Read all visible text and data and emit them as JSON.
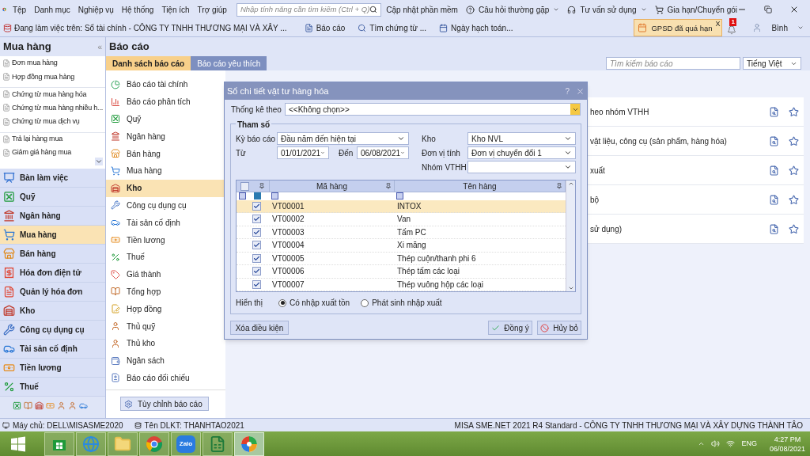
{
  "menu": {
    "items": [
      "Tệp",
      "Danh mục",
      "Nghiệp vụ",
      "Hệ thống",
      "Tiện ích",
      "Trợ giúp"
    ],
    "search_placeholder": "Nhập tính năng cần tìm kiếm (Ctrl + Q)",
    "links": [
      {
        "kind": "update",
        "label": "Cập nhật phần mềm"
      },
      {
        "kind": "help",
        "label": "Câu hỏi thường gặp"
      },
      {
        "kind": "support",
        "label": "Tư vấn sử dụng"
      },
      {
        "kind": "cart",
        "label": "Gia hạn/Chuyển gói"
      }
    ]
  },
  "toolbar": {
    "working_on": "Đang làm việc trên: Sổ tài chính - CÔNG TY TNHH THƯƠNG MẠI VÀ XÂY ...",
    "buttons": [
      {
        "kind": "report",
        "label": "Báo cáo"
      },
      {
        "kind": "search",
        "label": "Tìm chứng từ ..."
      },
      {
        "kind": "calendar",
        "label": "Ngày hạch toán..."
      }
    ],
    "alert": {
      "label": "GPSD đã quá hạn",
      "close": "X"
    },
    "notifications": "1",
    "user": "Bình"
  },
  "sidebar": {
    "title": "Mua hàng",
    "collapse": "«",
    "sub_items": [
      "Đơn mua hàng",
      "Hợp đồng mua hàng",
      "Chứng từ mua hàng hóa",
      "Chứng từ mua hàng nhiều h...",
      "Chứng từ mua dịch vụ",
      "Trả lại hàng mua",
      "Giảm giá hàng mua"
    ],
    "modules": [
      {
        "label": "Bàn làm việc",
        "kind": "desk",
        "selected": false
      },
      {
        "label": "Quỹ",
        "kind": "safe",
        "selected": false
      },
      {
        "label": "Ngân hàng",
        "kind": "bank",
        "selected": false
      },
      {
        "label": "Mua hàng",
        "kind": "cart",
        "selected": true
      },
      {
        "label": "Bán hàng",
        "kind": "store",
        "selected": false
      },
      {
        "label": "Hóa đơn điện tử",
        "kind": "einvoice",
        "selected": false
      },
      {
        "label": "Quản lý hóa đơn",
        "kind": "invoice",
        "selected": false
      },
      {
        "label": "Kho",
        "kind": "warehouse",
        "selected": false
      },
      {
        "label": "Công cụ dụng cụ",
        "kind": "tools",
        "selected": false
      },
      {
        "label": "Tài sản cố định",
        "kind": "car",
        "selected": false
      },
      {
        "label": "Tiền lương",
        "kind": "salary",
        "selected": false
      },
      {
        "label": "Thuế",
        "kind": "tax",
        "selected": false
      }
    ]
  },
  "reports": {
    "title": "Báo cáo",
    "tabs": [
      {
        "label": "Danh sách báo cáo",
        "selected": true
      },
      {
        "label": "Báo cáo yêu thích",
        "selected": false
      }
    ],
    "search_placeholder": "Tìm kiếm báo cáo",
    "language": "Tiếng Việt",
    "categories": [
      {
        "label": "Báo cáo tài chính",
        "kind": "pie",
        "selected": false
      },
      {
        "label": "Báo cáo phân tích",
        "kind": "chart",
        "selected": false
      },
      {
        "label": "Quỹ",
        "kind": "safe",
        "selected": false
      },
      {
        "label": "Ngân hàng",
        "kind": "bank",
        "selected": false
      },
      {
        "label": "Bán hàng",
        "kind": "store",
        "selected": false
      },
      {
        "label": "Mua hàng",
        "kind": "cart",
        "selected": false
      },
      {
        "label": "Kho",
        "kind": "warehouse",
        "selected": true
      },
      {
        "label": "Công cụ dụng cụ",
        "kind": "tools",
        "selected": false
      },
      {
        "label": "Tài sản cố định",
        "kind": "car",
        "selected": false
      },
      {
        "label": "Tiền lương",
        "kind": "salary",
        "selected": false
      },
      {
        "label": "Thuế",
        "kind": "tax",
        "selected": false
      },
      {
        "label": "Giá thành",
        "kind": "tag",
        "selected": false
      },
      {
        "label": "Tổng hợp",
        "kind": "book",
        "selected": false
      },
      {
        "label": "Hợp đồng",
        "kind": "contract",
        "selected": false
      },
      {
        "label": "Thủ quỹ",
        "kind": "person",
        "selected": false
      },
      {
        "label": "Thủ kho",
        "kind": "person",
        "selected": false
      },
      {
        "label": "Ngân sách",
        "kind": "budget",
        "selected": false
      },
      {
        "label": "Báo cáo đối chiếu",
        "kind": "compare",
        "selected": false
      }
    ],
    "customize": "Tùy chỉnh báo cáo",
    "list": [
      "heo nhóm VTHH",
      "vật liệu, công cụ (sản phẩm, hàng hóa)",
      "xuất",
      "bộ",
      "sử dụng)"
    ]
  },
  "dialog": {
    "title": "Sổ chi tiết vật tư hàng hóa",
    "help": "?",
    "group_by": {
      "label": "Thống kê theo",
      "value": "<<Không chọn>>"
    },
    "params_title": "Tham số",
    "period": {
      "label": "Kỳ báo cáo",
      "value": "Đầu năm đến hiện tại"
    },
    "from": {
      "label": "Từ",
      "value": "01/01/2021"
    },
    "to": {
      "label": "Đến",
      "value": "06/08/2021"
    },
    "warehouse": {
      "label": "Kho",
      "value": "Kho NVL"
    },
    "unit": {
      "label": "Đơn vị tính",
      "value": "Đơn vị chuyển đổi 1"
    },
    "group": {
      "label": "Nhóm VTHH"
    },
    "grid": {
      "columns": [
        "Mã hàng",
        "Tên hàng"
      ],
      "all_checked": false,
      "rows": [
        {
          "code": "VT00001",
          "name": "INTOX",
          "checked": true,
          "selected": true
        },
        {
          "code": "VT00002",
          "name": "Van",
          "checked": true,
          "selected": false
        },
        {
          "code": "VT00003",
          "name": "Tấm PC",
          "checked": true,
          "selected": false
        },
        {
          "code": "VT00004",
          "name": "Xi măng",
          "checked": true,
          "selected": false
        },
        {
          "code": "VT00005",
          "name": "Thép cuộn/thanh phi 6",
          "checked": true,
          "selected": false
        },
        {
          "code": "VT00006",
          "name": "Thép tấm các loại",
          "checked": true,
          "selected": false
        },
        {
          "code": "VT00007",
          "name": "Thép vuông hộp các loại",
          "checked": true,
          "selected": false
        }
      ]
    },
    "display": {
      "label": "Hiển thị",
      "options": [
        {
          "label": "Có nhập xuất tồn",
          "selected": true
        },
        {
          "label": "Phát sinh nhập xuất",
          "selected": false
        }
      ]
    },
    "buttons": [
      {
        "kind": "clear",
        "label": "Xóa điều kiện"
      },
      {
        "kind": "ok",
        "label": "Đồng ý"
      },
      {
        "kind": "cancel",
        "label": "Hủy bỏ"
      }
    ]
  },
  "status_bar": {
    "server": "Máy chủ: DELL\\MISASME2020",
    "db": "Tên DLKT: THANHTAO2021",
    "product": "MISA SME.NET 2021 R4 Standard - CÔNG TY TNHH THƯƠNG MẠI VÀ XÂY DỰNG THÀNH TÂO"
  },
  "taskbar": {
    "apps": [
      {
        "kind": "store"
      },
      {
        "kind": "ie"
      },
      {
        "kind": "folder"
      },
      {
        "kind": "chrome"
      },
      {
        "kind": "zalo",
        "label": "Zalo"
      },
      {
        "kind": "excel"
      },
      {
        "kind": "misa",
        "selected": true
      }
    ],
    "language": "ENG",
    "time": "4:27 PM",
    "date": "06/08/2021"
  }
}
